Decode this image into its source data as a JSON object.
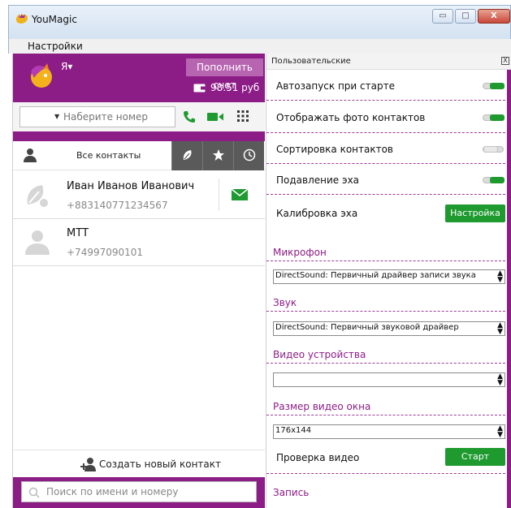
{
  "window": {
    "title": "YouMagic",
    "controls": {
      "minimize": "▭",
      "maximize": "□",
      "close": "X"
    }
  },
  "menubar": {
    "settings": "Настройки"
  },
  "account": {
    "me_label": "Я▾",
    "topup_button": "Пополнить счет",
    "balance": "98.51 руб"
  },
  "dialer": {
    "placeholder": "Наберите номер",
    "dropdown_arrow": "▼"
  },
  "tabs": {
    "all_contacts": "Все контакты"
  },
  "contacts": [
    {
      "name": "Иван Иванов Иванович",
      "phone": "+883140771234567"
    },
    {
      "name": "МТТ",
      "phone": "+74997090101"
    }
  ],
  "create_contact": "Создать новый контакт",
  "search": {
    "placeholder": "Поиск по имени и номеру"
  },
  "settings_panel": {
    "title": "Пользовательские",
    "close": "X",
    "rows": [
      {
        "label": "Автозапуск при старте",
        "toggle": true
      },
      {
        "label": "Отображать фото контактов",
        "toggle": true
      },
      {
        "label": "Сортировка контактов",
        "toggle": false
      },
      {
        "label": "Подавление эха",
        "toggle": true
      }
    ],
    "echo_calibration": {
      "label": "Калибровка эха",
      "button": "Настройка"
    },
    "microphone": {
      "label": "Микрофон",
      "value": "DirectSound: Первичный драйвер записи звука"
    },
    "sound": {
      "label": "Звук",
      "value": "DirectSound: Первичный звуковой драйвер"
    },
    "video_devices": {
      "label": "Видео устройства",
      "value": ""
    },
    "video_size": {
      "label": "Размер видео окна",
      "value": "176x144"
    },
    "video_check": {
      "label": "Проверка видео",
      "button": "Старт"
    },
    "recording": {
      "label": "Запись"
    }
  },
  "colors": {
    "brand_purple": "#8c1c86",
    "topup_bg": "#b764b1",
    "green": "#1e9a2f",
    "tab_dark": "#5a5a5a"
  },
  "icons": [
    "youmagic-logo-icon",
    "avatar-icon",
    "wallet-icon",
    "phone-icon",
    "video-icon",
    "dialpad-icon",
    "person-icon",
    "leaf-icon",
    "star-icon",
    "clock-icon",
    "mail-icon",
    "add-contact-icon",
    "search-icon"
  ]
}
